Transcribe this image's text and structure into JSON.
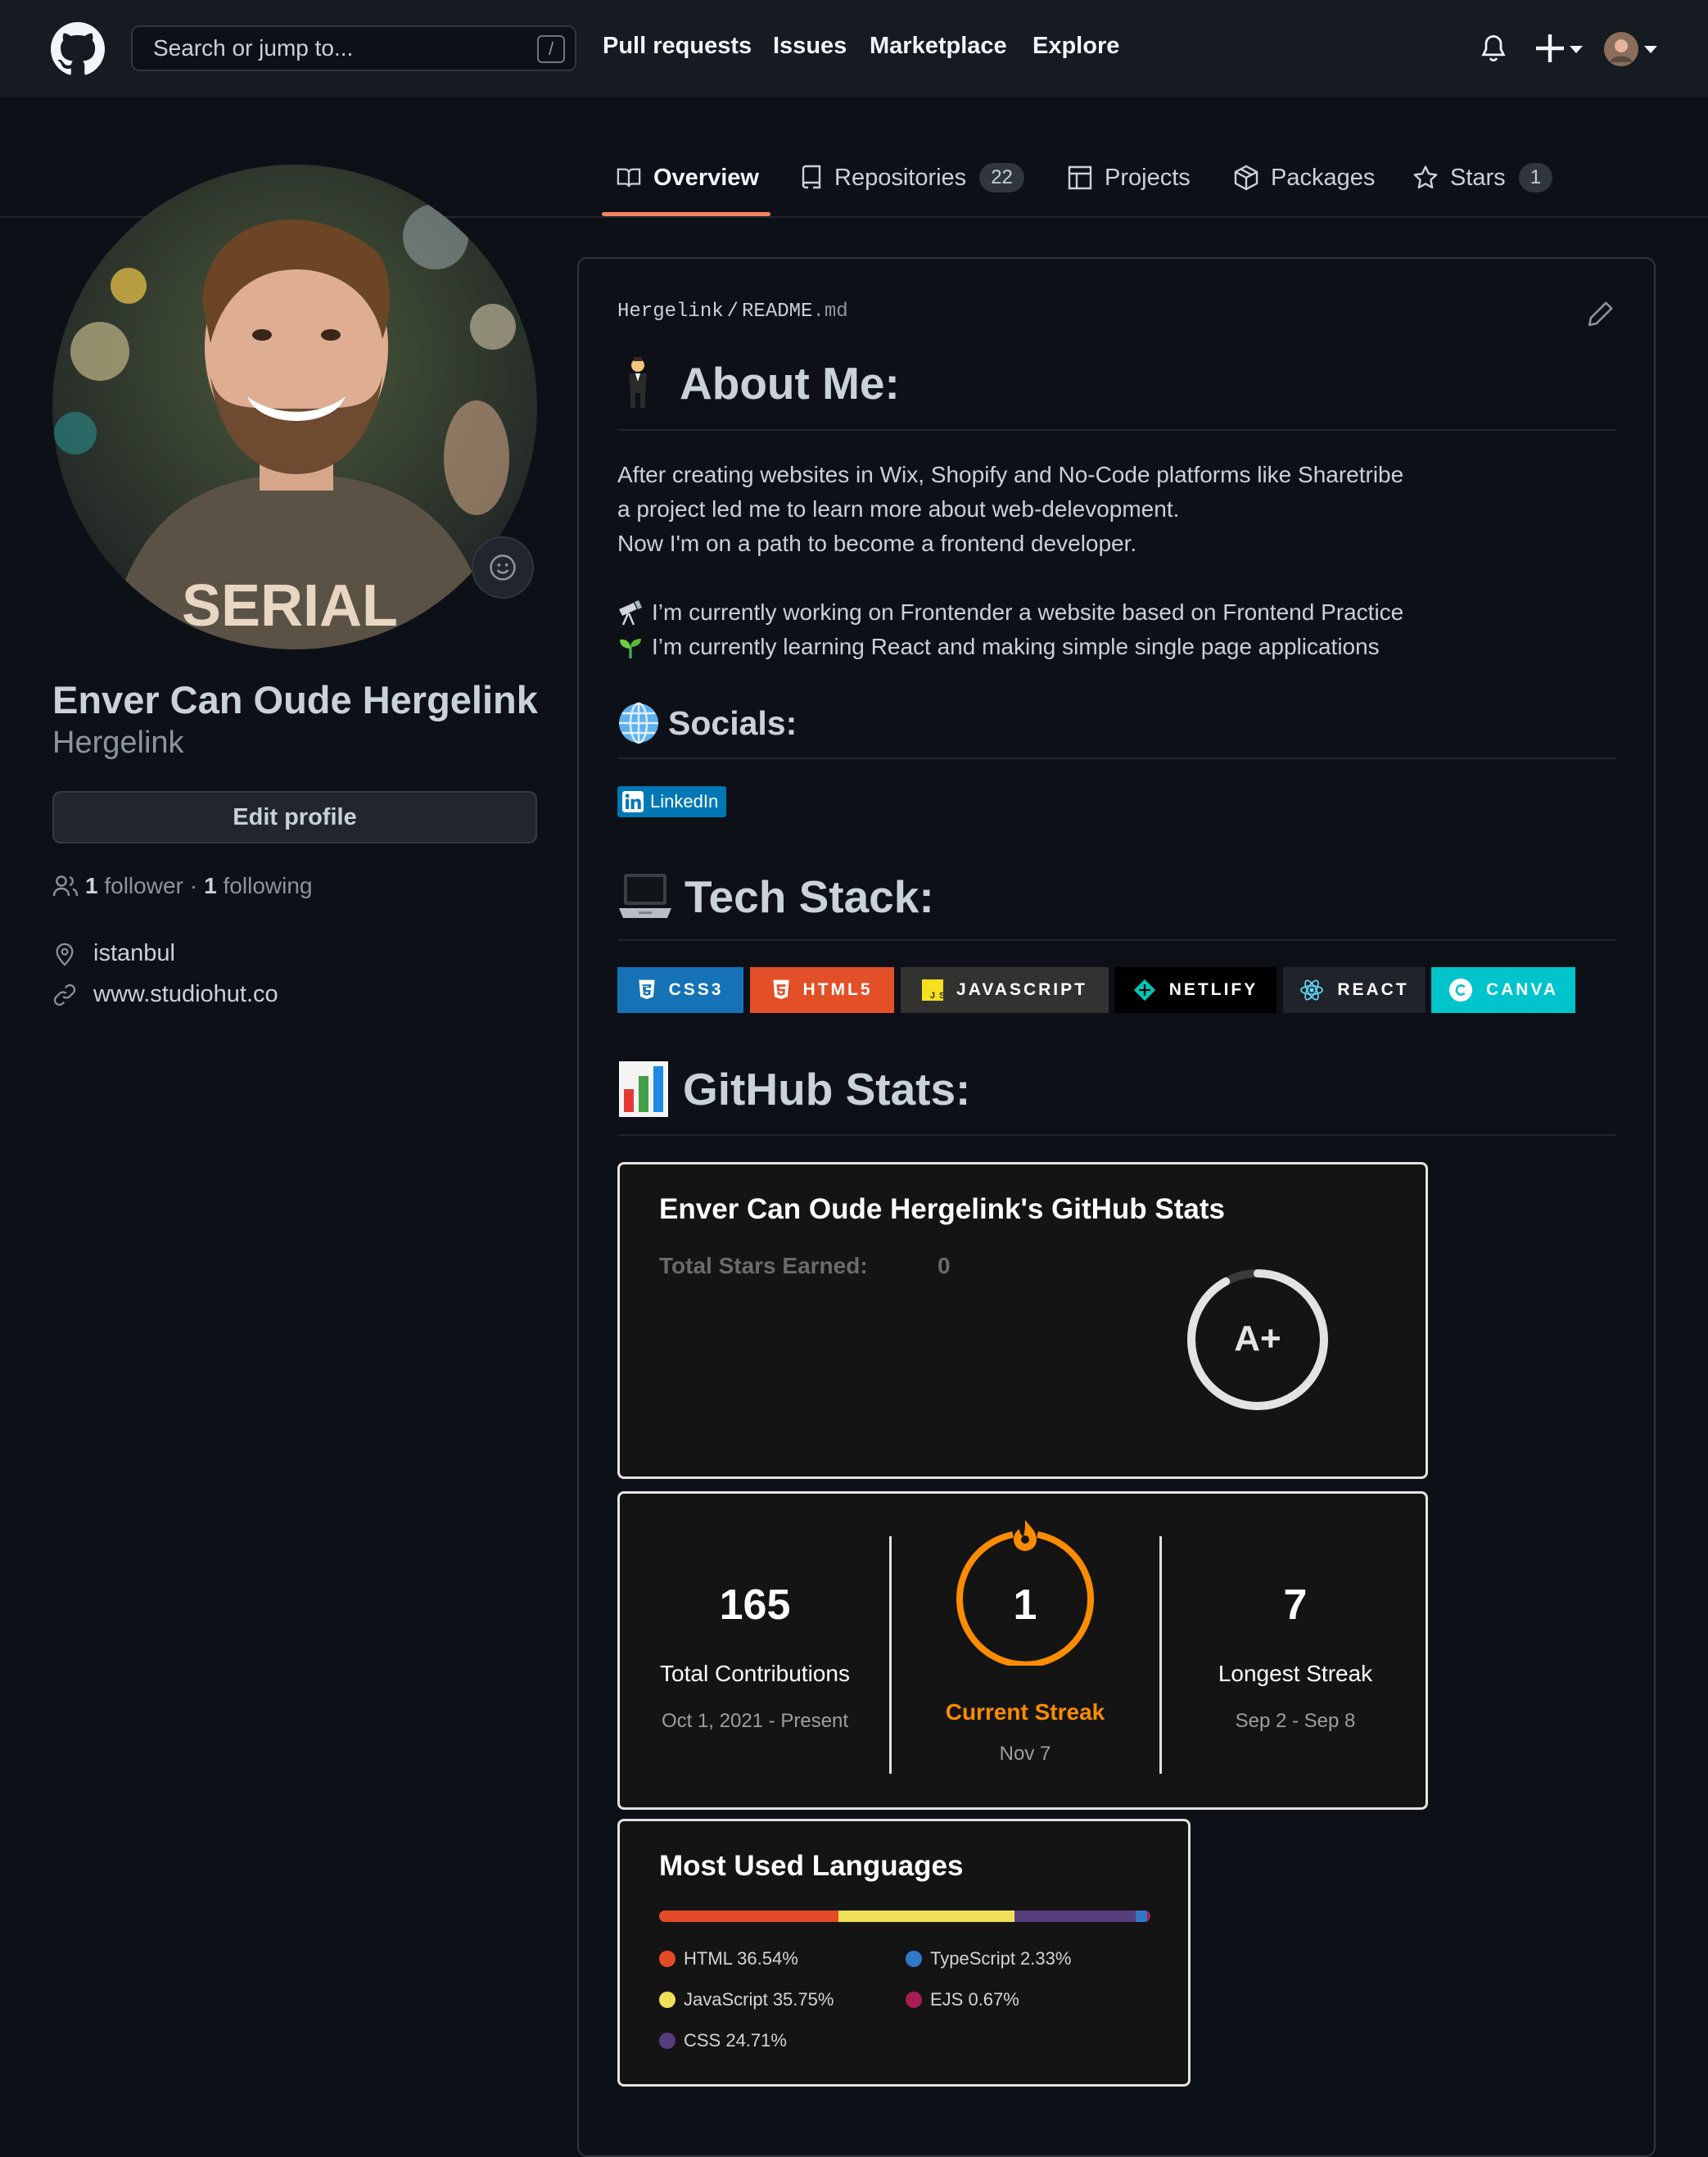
{
  "header": {
    "search_placeholder": "Search or jump to...",
    "slash_key": "/",
    "nav": [
      "Pull requests",
      "Issues",
      "Marketplace",
      "Explore"
    ]
  },
  "tabs": {
    "overview": "Overview",
    "repositories": "Repositories",
    "repositories_count": "22",
    "projects": "Projects",
    "packages": "Packages",
    "stars": "Stars",
    "stars_count": "1"
  },
  "profile": {
    "shirt_text": "SERIAL",
    "full_name": "Enver Can Oude Hergelink",
    "username": "Hergelink",
    "edit_button": "Edit profile",
    "followers_count": "1",
    "followers_label": "follower",
    "separator": "·",
    "following_count": "1",
    "following_label": "following",
    "location": "istanbul",
    "website": "www.studiohut.co"
  },
  "readme": {
    "path_user": "Hergelink",
    "path_sep": "/",
    "path_file": "README",
    "path_ext": ".md",
    "about_title": "About Me:",
    "about_lines": [
      "After creating websites in Wix, Shopify and No-Code platforms like Sharetribe",
      "a project led me to learn more about web-delevopment.",
      "Now I'm on a path to become a frontend developer."
    ],
    "working_on": "I’m currently working on Frontender a website based on Frontend Practice",
    "learning": "I’m currently learning React and making simple single page applications",
    "socials_title": "Socials:",
    "linkedin_label": "LinkedIn",
    "tech_title": "Tech Stack:",
    "badges": [
      "CSS3",
      "HTML5",
      "JAVASCRIPT",
      "NETLIFY",
      "REACT",
      "CANVA"
    ],
    "badge_colors": [
      "#1572b6",
      "#e34f26",
      "#323330",
      "#000000",
      "#20232a",
      "#00c4cc"
    ],
    "stats_title": "GitHub Stats:"
  },
  "stats_card": {
    "title": "Enver Can Oude Hergelink's GitHub Stats",
    "stars_label": "Total Stars Earned:",
    "stars_value": "0",
    "grade": "A+",
    "rank_progress": 0.92
  },
  "streak_card": {
    "total_value": "165",
    "total_label": "Total Contributions",
    "total_range": "Oct 1, 2021 - Present",
    "current_value": "1",
    "current_label": "Current Streak",
    "current_date": "Nov 7",
    "longest_value": "7",
    "longest_label": "Longest Streak",
    "longest_range": "Sep 2 - Sep 8",
    "accent": "#fb8c00"
  },
  "languages_card": {
    "title": "Most Used Languages",
    "languages": [
      {
        "name": "HTML 36.54%",
        "percent": 36.54,
        "color": "#e34c26"
      },
      {
        "name": "JavaScript 35.75%",
        "percent": 35.75,
        "color": "#f1e05a"
      },
      {
        "name": "CSS 24.71%",
        "percent": 24.71,
        "color": "#563d7c"
      },
      {
        "name": "TypeScript 2.33%",
        "percent": 2.33,
        "color": "#3178c6"
      },
      {
        "name": "EJS 0.67%",
        "percent": 0.67,
        "color": "#a91e50"
      }
    ]
  }
}
